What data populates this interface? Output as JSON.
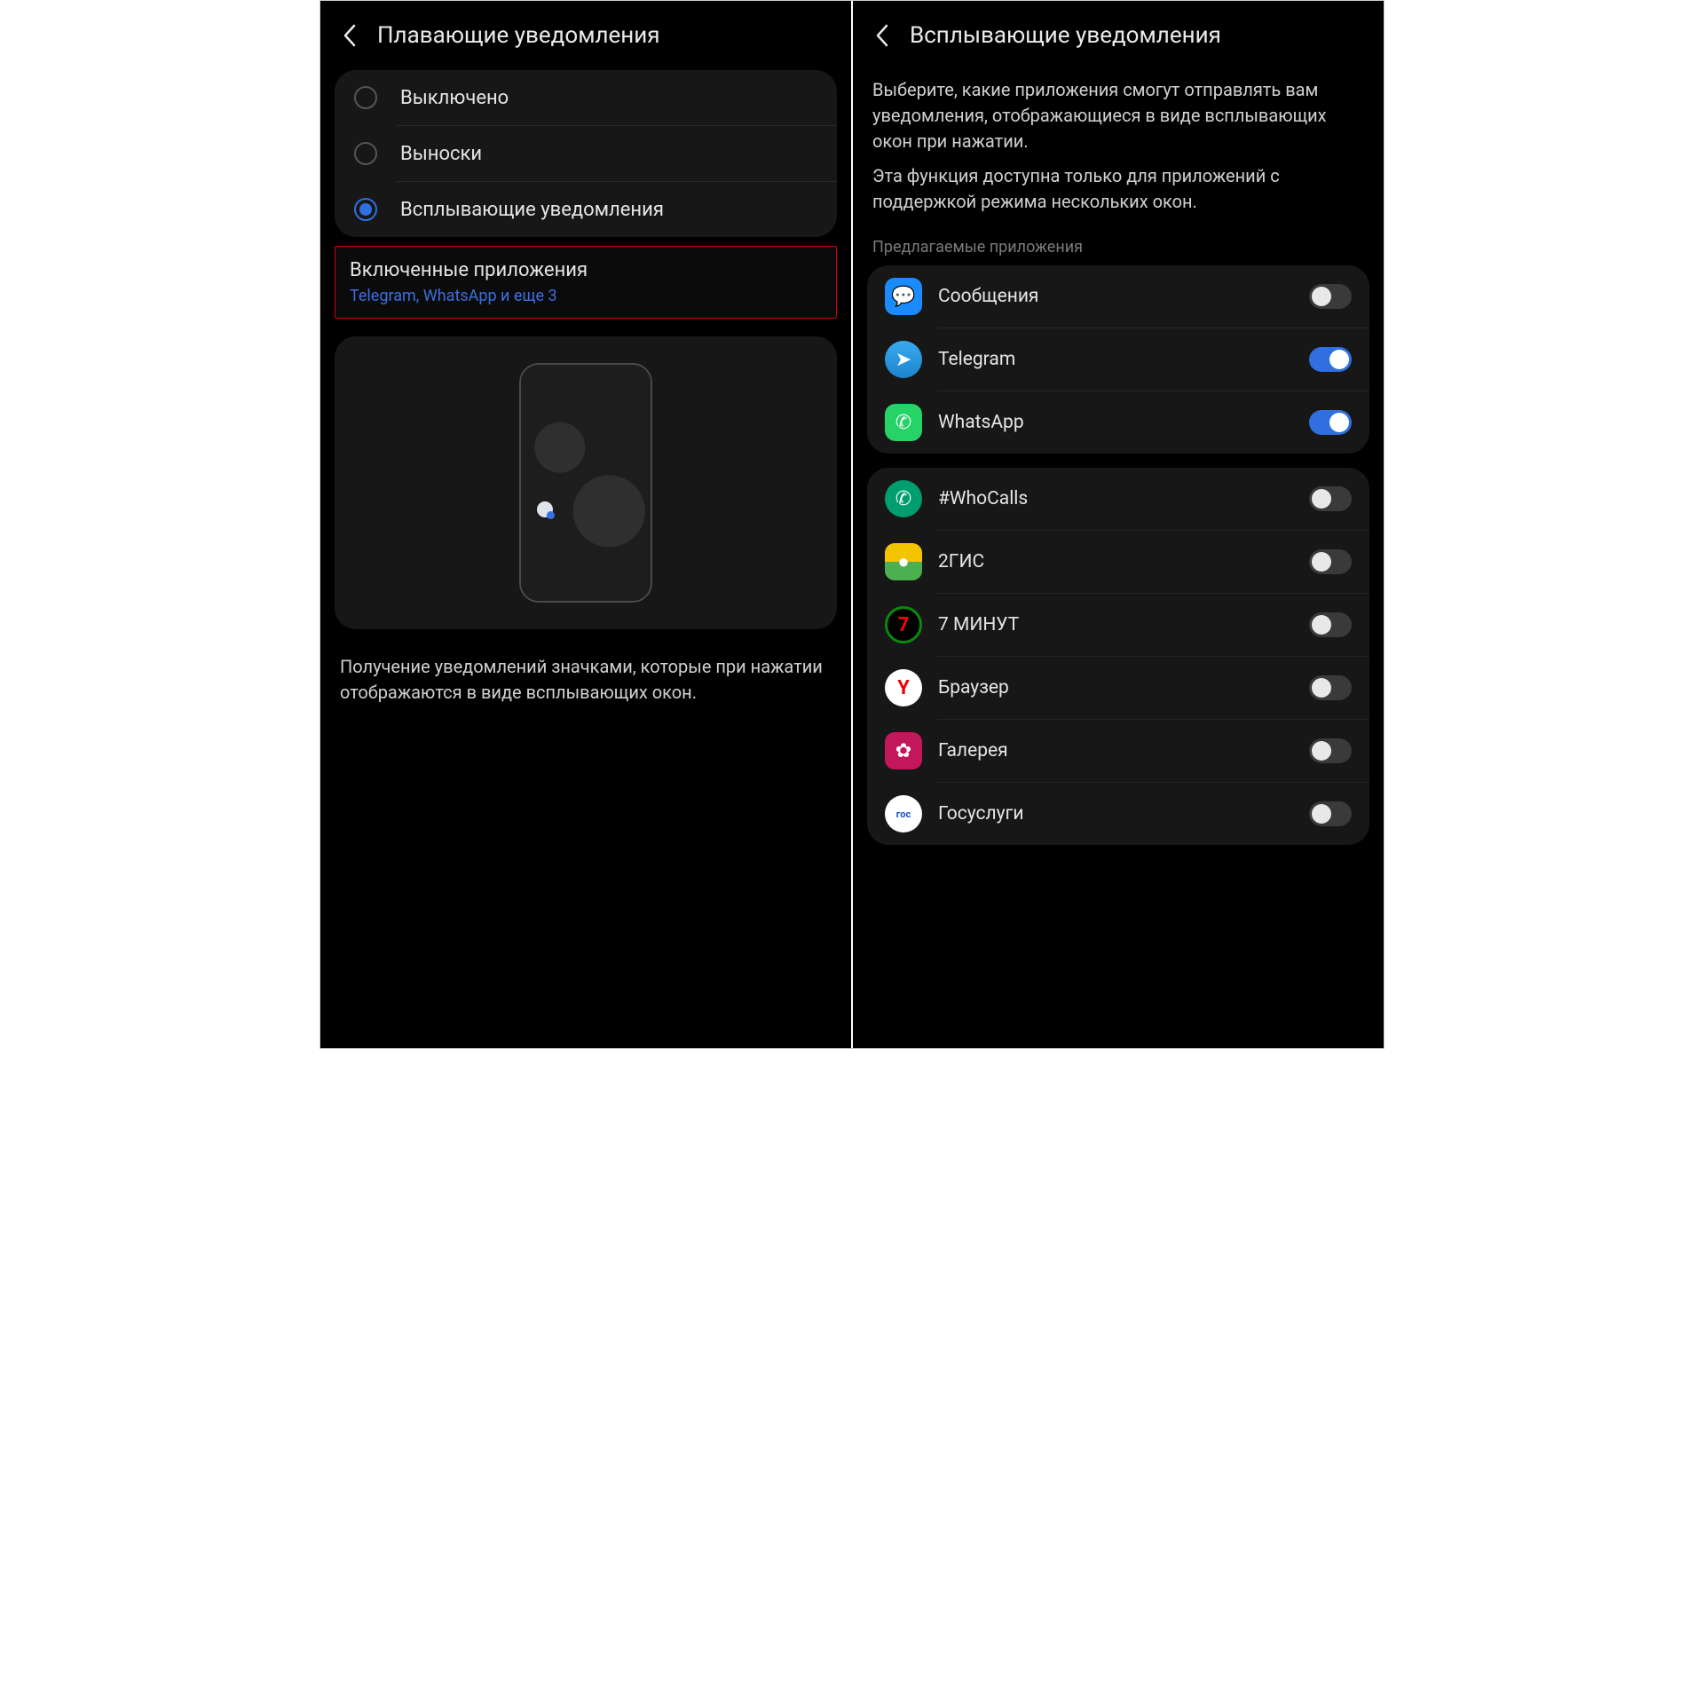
{
  "left": {
    "title": "Плавающие уведомления",
    "radios": [
      {
        "label": "Выключено",
        "selected": false
      },
      {
        "label": "Выноски",
        "selected": false
      },
      {
        "label": "Всплывающие уведомления",
        "selected": true
      }
    ],
    "enabled_title": "Включенные приложения",
    "enabled_sub": "Telegram, WhatsApp и еще 3",
    "description": "Получение уведомлений значками, которые при нажатии отображаются в виде всплывающих окон."
  },
  "right": {
    "title": "Всплывающие уведомления",
    "desc1": "Выберите, какие приложения смогут отправлять вам уведомления, отображающиеся в виде всплывающих окон при нажатии.",
    "desc2": "Эта функция доступна только для приложений с поддержкой режима нескольких окон.",
    "section_label": "Предлагаемые приложения",
    "suggested": [
      {
        "name": "Сообщения",
        "icon": "messages",
        "on": false
      },
      {
        "name": "Telegram",
        "icon": "telegram",
        "on": true
      },
      {
        "name": "WhatsApp",
        "icon": "whatsapp",
        "on": true
      }
    ],
    "apps": [
      {
        "name": "#WhoCalls",
        "icon": "whocalls",
        "on": false
      },
      {
        "name": "2ГИС",
        "icon": "2gis",
        "on": false
      },
      {
        "name": "7 МИНУТ",
        "icon": "7min",
        "on": false
      },
      {
        "name": "Браузер",
        "icon": "browser",
        "on": false
      },
      {
        "name": "Галерея",
        "icon": "gallery",
        "on": false
      },
      {
        "name": "Госуслуги",
        "icon": "gosuslugi",
        "on": false
      }
    ]
  },
  "icon_glyphs": {
    "messages": "💬",
    "telegram": "➤",
    "whatsapp": "✆",
    "whocalls": "✆",
    "2gis": "●",
    "7min": "7",
    "browser": "Y",
    "gallery": "✿",
    "gosuslugi": "гос"
  }
}
